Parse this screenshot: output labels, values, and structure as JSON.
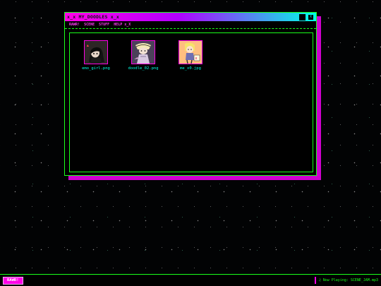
{
  "window": {
    "title": "x_x MY_DOODLES x_x",
    "close_label": "X",
    "menu": [
      "RAWR!",
      "SCENE",
      "STUFF",
      "HELP x_X"
    ]
  },
  "files": [
    {
      "name": "emo_girl.png",
      "icon": "emo-girl-thumbnail"
    },
    {
      "name": "doodle_02.png",
      "icon": "doodle-thumbnail"
    },
    {
      "name": "me_x0.jpg",
      "icon": "selfie-thumbnail"
    }
  ],
  "taskbar": {
    "start_label": "RAWR!",
    "now_playing_icon": "♫",
    "now_playing": "Now Playing: SCENE_JAM.mp3"
  },
  "colors": {
    "accent_pink": "#ff00e6",
    "accent_green": "#1aff1a",
    "accent_cyan": "#00ffe6"
  }
}
